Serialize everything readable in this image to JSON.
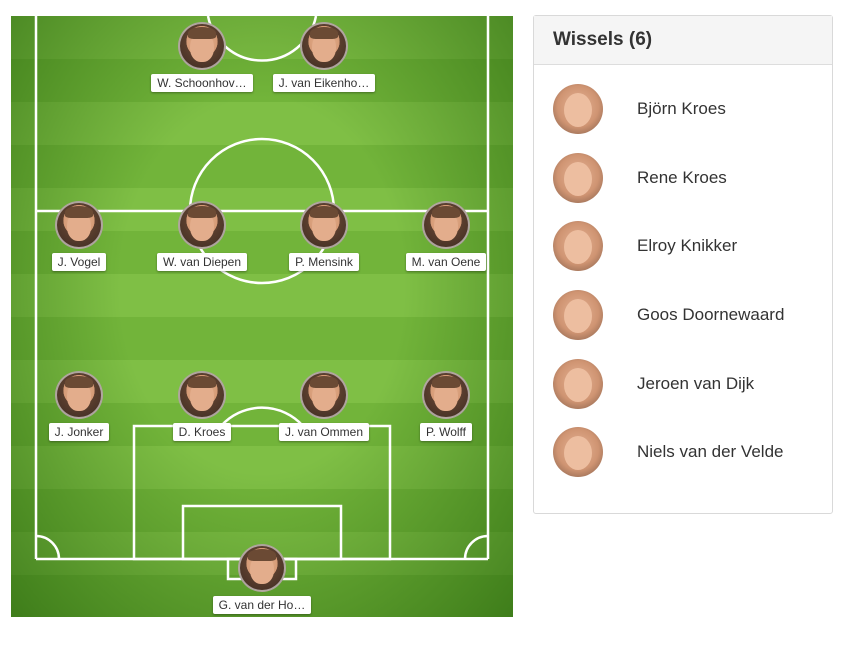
{
  "pitch": {
    "players": [
      {
        "name": "W. Schoonhov…",
        "slot": "fwd-left"
      },
      {
        "name": "J. van Eikenho…",
        "slot": "fwd-right"
      },
      {
        "name": "J. Vogel",
        "slot": "mid-1"
      },
      {
        "name": "W. van Diepen",
        "slot": "mid-2"
      },
      {
        "name": "P. Mensink",
        "slot": "mid-3"
      },
      {
        "name": "M. van Oene",
        "slot": "mid-4"
      },
      {
        "name": "J. Jonker",
        "slot": "def-1"
      },
      {
        "name": "D. Kroes",
        "slot": "def-2"
      },
      {
        "name": "J. van Ommen",
        "slot": "def-3"
      },
      {
        "name": "P. Wolff",
        "slot": "def-4"
      },
      {
        "name": "G. van der Ho…",
        "slot": "gk"
      }
    ]
  },
  "bench": {
    "title": "Wissels (6)",
    "items": [
      {
        "name": "Björn Kroes"
      },
      {
        "name": "Rene Kroes"
      },
      {
        "name": "Elroy Knikker"
      },
      {
        "name": "Goos Doornewaard"
      },
      {
        "name": "Jeroen van Dijk"
      },
      {
        "name": "Niels van der Velde"
      }
    ]
  },
  "colors": {
    "pitch_light": "#7fbf45",
    "pitch_dark": "#72b43a",
    "pitch_lines": "#ffffff",
    "panel_header_bg": "#f5f5f5"
  }
}
